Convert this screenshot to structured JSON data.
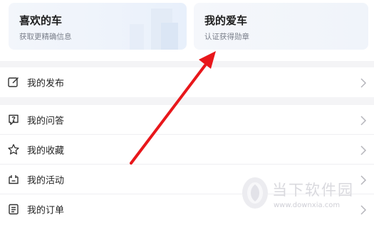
{
  "cards": {
    "favorite": {
      "title": "喜欢的车",
      "subtitle": "获取更精确信息"
    },
    "my_car": {
      "title": "我的爱车",
      "subtitle": "认证获得勋章"
    }
  },
  "menu": {
    "group1": [
      {
        "label": "我的发布",
        "icon": "edit-icon"
      }
    ],
    "group2": [
      {
        "label": "我的问答",
        "icon": "question-bubble-icon"
      },
      {
        "label": "我的收藏",
        "icon": "star-icon"
      },
      {
        "label": "我的活动",
        "icon": "activity-icon"
      },
      {
        "label": "我的订单",
        "icon": "order-list-icon"
      }
    ]
  },
  "watermark": {
    "text": "当下软件园",
    "url": "www.downxia.com"
  },
  "colors": {
    "annotation_arrow": "#e8171b",
    "icon": "#333333",
    "chevron": "#b5b5bb"
  }
}
